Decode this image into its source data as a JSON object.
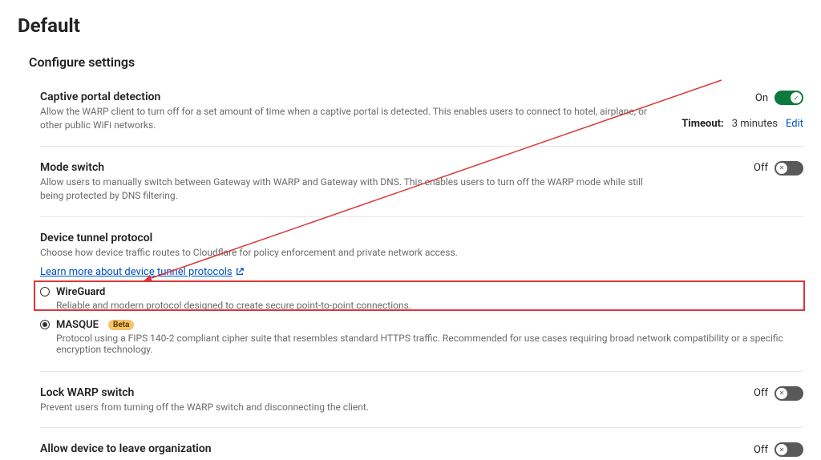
{
  "page_title": "Default",
  "section_title": "Configure settings",
  "captive": {
    "title": "Captive portal detection",
    "desc": "Allow the WARP client to turn off for a set amount of time when a captive portal is detected. This enables users to connect to hotel, airplane, or other public WiFi networks.",
    "state_label": "On",
    "timeout_label": "Timeout:",
    "timeout_value": "3 minutes",
    "edit": "Edit"
  },
  "mode_switch": {
    "title": "Mode switch",
    "desc": "Allow users to manually switch between Gateway with WARP and Gateway with DNS. This enables users to turn off the WARP mode while still being protected by DNS filtering.",
    "state_label": "Off"
  },
  "tunnel": {
    "title": "Device tunnel protocol",
    "desc": "Choose how device traffic routes to Cloudflare for policy enforcement and private network access.",
    "learn_more": "Learn more about device tunnel protocols",
    "wireguard": {
      "label": "WireGuard",
      "desc": "Reliable and modern protocol designed to create secure point-to-point connections."
    },
    "masque": {
      "label": "MASQUE",
      "badge": "Beta",
      "desc": "Protocol using a FIPS 140-2 compliant cipher suite that resembles standard HTTPS traffic. Recommended for use cases requiring broad network compatibility or a specific encryption technology."
    }
  },
  "lock": {
    "title": "Lock WARP switch",
    "desc": "Prevent users from turning off the WARP switch and disconnecting the client.",
    "state_label": "Off"
  },
  "allow_leave": {
    "title": "Allow device to leave organization",
    "state_label": "Off"
  }
}
